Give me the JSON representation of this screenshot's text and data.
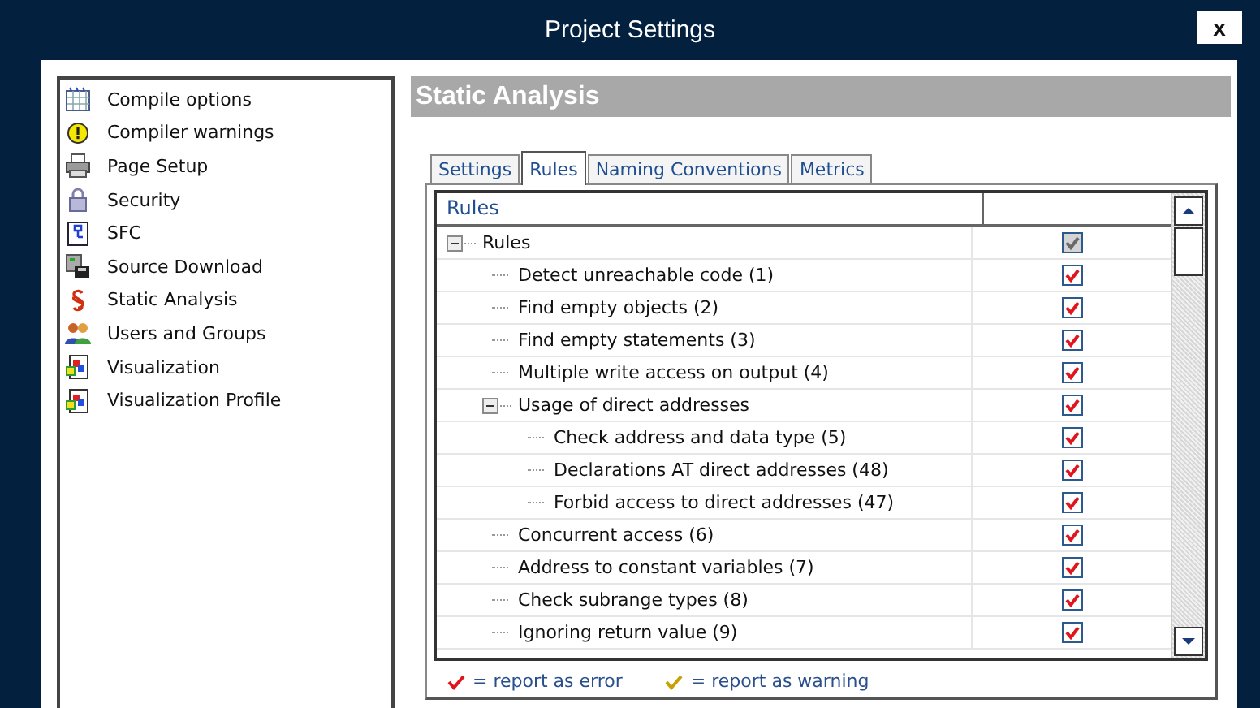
{
  "window": {
    "title": "Project Settings",
    "close": "x"
  },
  "sidebar": {
    "items": [
      {
        "label": "Compile options",
        "kind": "grid"
      },
      {
        "label": "Compiler warnings",
        "kind": "warning"
      },
      {
        "label": "Page Setup",
        "kind": "printer"
      },
      {
        "label": "Security",
        "kind": "lock"
      },
      {
        "label": "SFC",
        "kind": "chart"
      },
      {
        "label": "Source Download",
        "kind": "download"
      },
      {
        "label": "Static Analysis",
        "kind": "section"
      },
      {
        "label": "Users and Groups",
        "kind": "users"
      },
      {
        "label": "Visualization",
        "kind": "visual"
      },
      {
        "label": "Visualization Profile",
        "kind": "visual"
      }
    ]
  },
  "header": "Static Analysis",
  "tabs": [
    {
      "label": "Settings",
      "selected": false
    },
    {
      "label": "Rules",
      "selected": true
    },
    {
      "label": "Naming Conventions",
      "selected": false
    },
    {
      "label": "Metrics",
      "selected": false
    }
  ],
  "rules": {
    "columns": [
      "Rules"
    ],
    "tree": [
      {
        "label": "Rules",
        "checked": true,
        "grayed": true,
        "expanded": true,
        "children": [
          {
            "label": "Detect unreachable code (1)",
            "checked": true,
            "grayed": false
          },
          {
            "label": "Find empty objects (2)",
            "checked": true,
            "grayed": false
          },
          {
            "label": "Find empty statements (3)",
            "checked": true,
            "grayed": false
          },
          {
            "label": "Multiple write access on output (4)",
            "checked": true,
            "grayed": false
          },
          {
            "label": "Usage of direct addresses",
            "checked": true,
            "grayed": false,
            "expanded": true,
            "children": [
              {
                "label": "Check address and data type (5)",
                "checked": true,
                "grayed": false
              },
              {
                "label": "Declarations AT direct addresses (48)",
                "checked": true,
                "grayed": false
              },
              {
                "label": "Forbid access to direct addresses (47)",
                "checked": true,
                "grayed": false
              }
            ]
          },
          {
            "label": "Concurrent access (6)",
            "checked": true,
            "grayed": false
          },
          {
            "label": "Address to constant variables (7)",
            "checked": true,
            "grayed": false
          },
          {
            "label": "Check subrange types (8)",
            "checked": true,
            "grayed": false
          },
          {
            "label": "Ignoring return value (9)",
            "checked": true,
            "grayed": false
          }
        ]
      }
    ]
  },
  "legend": [
    {
      "kind": "error",
      "label": "= report as error"
    },
    {
      "kind": "warning",
      "label": "= report as warning"
    }
  ]
}
